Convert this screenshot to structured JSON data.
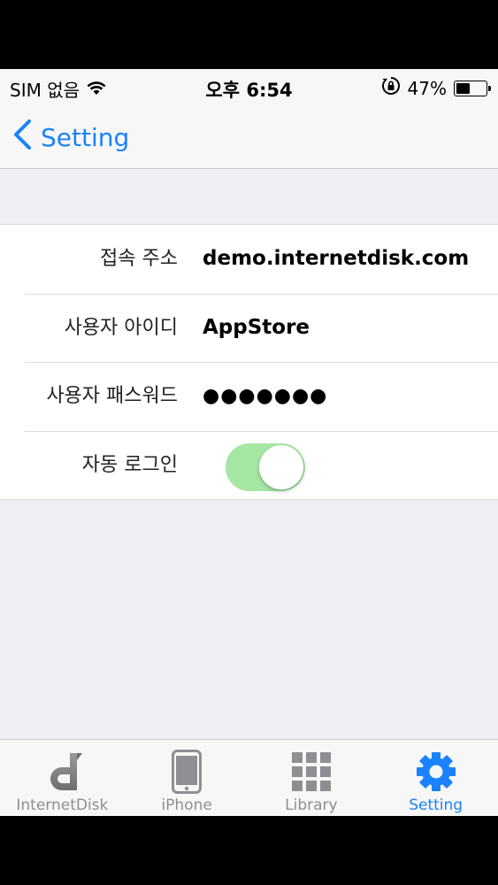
{
  "status_bar": {
    "carrier": "SIM 없음",
    "time": "오후 6:54",
    "battery_percent": "47%",
    "battery_level": 0.47
  },
  "nav": {
    "back_label": "Setting"
  },
  "settings": {
    "server_label": "접속 주소",
    "server_value": "demo.internetdisk.com",
    "user_id_label": "사용자 아이디",
    "user_id_value": "AppStore",
    "password_label": "사용자 패스워드",
    "password_value": "●●●●●●●",
    "auto_login_label": "자동 로그인",
    "auto_login_on": true
  },
  "tabs": [
    {
      "label": "InternetDisk",
      "icon": "internetdisk-logo-icon",
      "active": false
    },
    {
      "label": "iPhone",
      "icon": "iphone-icon",
      "active": false
    },
    {
      "label": "Library",
      "icon": "grid-icon",
      "active": false
    },
    {
      "label": "Setting",
      "icon": "gear-icon",
      "active": true
    }
  ],
  "colors": {
    "accent": "#1a82fb",
    "toggle_on": "#a5e6a3",
    "inactive_tab": "#8e8e93"
  }
}
